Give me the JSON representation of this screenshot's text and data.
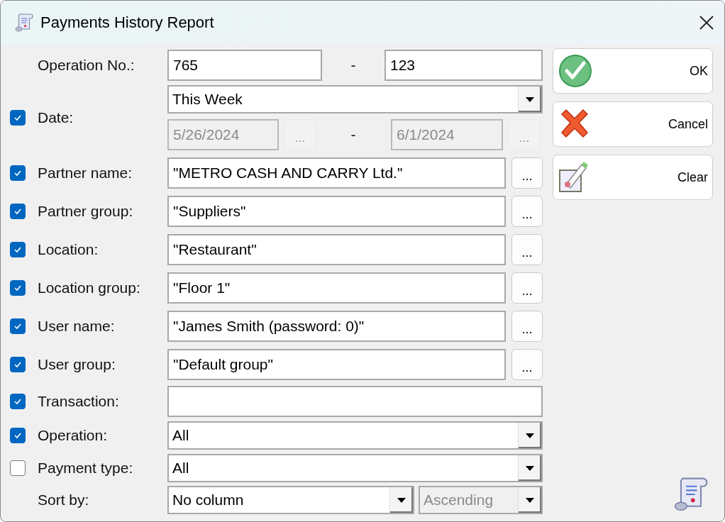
{
  "window": {
    "title": "Payments History Report"
  },
  "rows": [
    {
      "kind": "range",
      "label": "Operation No.:",
      "from": "765",
      "separator": "-",
      "to": "123"
    },
    {
      "kind": "date",
      "label": "Date:",
      "checked": true,
      "period": "This Week",
      "from": "5/26/2024",
      "from_button": "...",
      "separator": "-",
      "to": "6/1/2024",
      "to_button": "...",
      "disabled": true
    },
    {
      "kind": "lookup",
      "label": "Partner name:",
      "checked": true,
      "value": "\"METRO CASH AND CARRY Ltd.\"",
      "button": "..."
    },
    {
      "kind": "lookup",
      "label": "Partner group:",
      "checked": true,
      "value": "\"Suppliers\"",
      "button": "..."
    },
    {
      "kind": "lookup",
      "label": "Location:",
      "checked": true,
      "value": "\"Restaurant\"",
      "button": "..."
    },
    {
      "kind": "lookup",
      "label": "Location group:",
      "checked": true,
      "value": "\"Floor 1\"",
      "button": "..."
    },
    {
      "kind": "lookup",
      "label": "User name:",
      "checked": true,
      "value": "\"James Smith (password: 0)\"",
      "button": "..."
    },
    {
      "kind": "lookup",
      "label": "User group:",
      "checked": true,
      "value": "\"Default group\"",
      "button": "..."
    },
    {
      "kind": "text",
      "label": "Transaction:",
      "checked": true
    },
    {
      "kind": "combo",
      "label": "Operation:",
      "checked": true,
      "value": "All"
    },
    {
      "kind": "combo",
      "label": "Payment type:",
      "checked": false,
      "value": "All"
    },
    {
      "kind": "sort",
      "label": "Sort by:",
      "column": "No column",
      "order": "Ascending",
      "order_disabled": true
    }
  ],
  "buttons": [
    {
      "kind": "ok",
      "label": "OK"
    },
    {
      "kind": "cancel",
      "label": "Cancel"
    },
    {
      "kind": "clear",
      "label": "Clear"
    }
  ]
}
